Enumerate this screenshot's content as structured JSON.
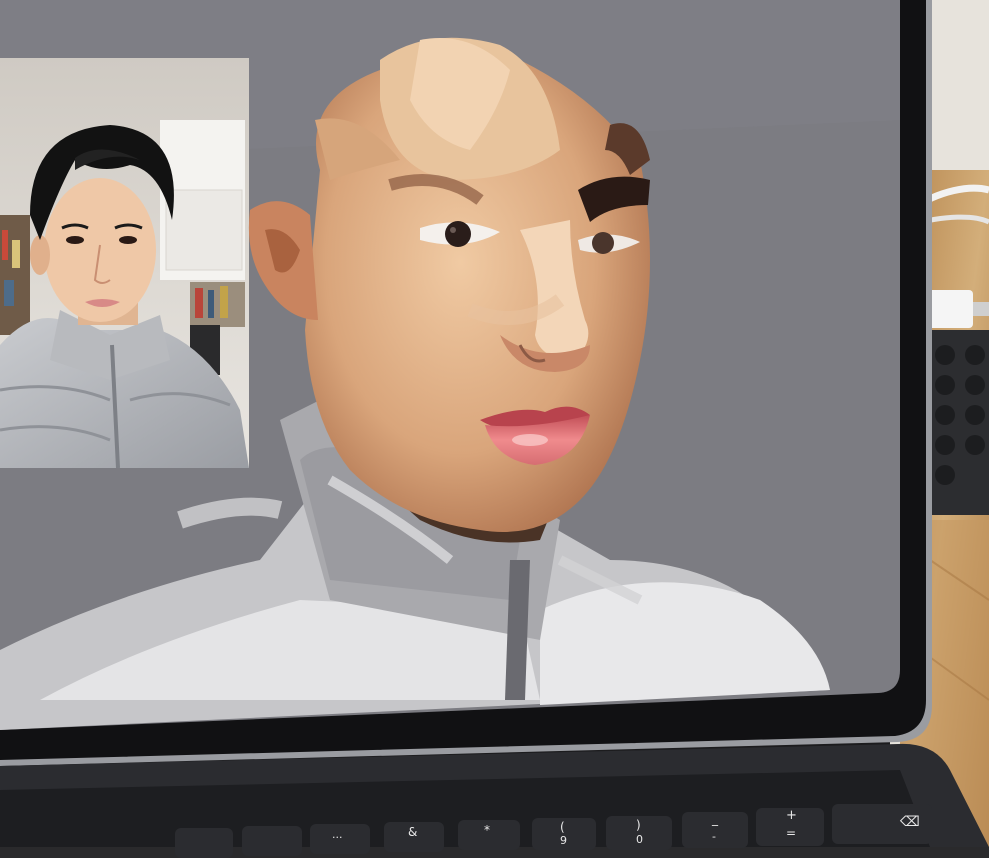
{
  "scene": {
    "description_elements": [
      "desk-surface",
      "ipad-frame",
      "ipad-screen",
      "reference-photo",
      "digital-painting",
      "keyboard"
    ]
  },
  "keyboard": {
    "keys": [
      "",
      "",
      "...",
      "&",
      "*",
      "(",
      ")",
      "_",
      "+",
      "⌫"
    ],
    "keys_lower": [
      "",
      "",
      "",
      "",
      "",
      "9",
      "0",
      "-",
      "=",
      ""
    ]
  },
  "colors": {
    "screen_bg": "#7b7b81",
    "frame": "#121213",
    "desk": "#c9a36f",
    "skin_light": "#e8c09a",
    "skin_mid": "#c98f67",
    "skin_dark": "#8e5b3e",
    "jacket_light": "#e9e9ea",
    "jacket_mid": "#b5b5b8",
    "jacket_dark": "#6d6d71",
    "lips": "#d46a6e",
    "hair_black": "#121212"
  }
}
